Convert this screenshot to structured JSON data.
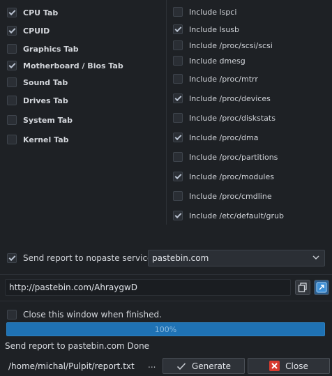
{
  "tabs": [
    {
      "label": "CPU Tab",
      "checked": true
    },
    {
      "label": "CPUID",
      "checked": true
    },
    {
      "label": "Graphics Tab",
      "checked": false
    },
    {
      "label": "Motherboard / Bios Tab",
      "checked": true
    },
    {
      "label": "Sound Tab",
      "checked": false
    },
    {
      "label": "Drives Tab",
      "checked": false
    },
    {
      "label": "System Tab",
      "checked": false
    },
    {
      "label": "Kernel Tab",
      "checked": false
    }
  ],
  "includes": [
    {
      "label": "Include lspci",
      "checked": false
    },
    {
      "label": "Include lsusb",
      "checked": true
    },
    {
      "label": "Include /proc/scsi/scsi",
      "checked": false
    },
    {
      "label": "Include dmesg",
      "checked": false
    },
    {
      "label": "Include /proc/mtrr",
      "checked": false
    },
    {
      "label": "Include /proc/devices",
      "checked": true
    },
    {
      "label": "Include /proc/diskstats",
      "checked": false
    },
    {
      "label": "Include /proc/dma",
      "checked": true
    },
    {
      "label": "Include /proc/partitions",
      "checked": false
    },
    {
      "label": "Include /proc/modules",
      "checked": true
    },
    {
      "label": "Include /proc/cmdline",
      "checked": false
    },
    {
      "label": "Include /etc/default/grub",
      "checked": true
    }
  ],
  "nopaste": {
    "label": "Send report to nopaste service:",
    "checked": true,
    "service": "pastebin.com"
  },
  "url": "http://pastebin.com/AhraygwD",
  "close_when_finished": {
    "label": "Close this window when finished.",
    "checked": false
  },
  "progress": {
    "value": 1.0,
    "text": "100%"
  },
  "status": "Send report to pastebin.com Done",
  "path": "/home/michal/Pulpit/report.txt",
  "path_button": "...",
  "buttons": {
    "generate": "Generate",
    "close": "Close"
  },
  "colors": {
    "background": "#1e2125",
    "progress": "#1a6aa8",
    "close_icon": "#d83a2e"
  }
}
